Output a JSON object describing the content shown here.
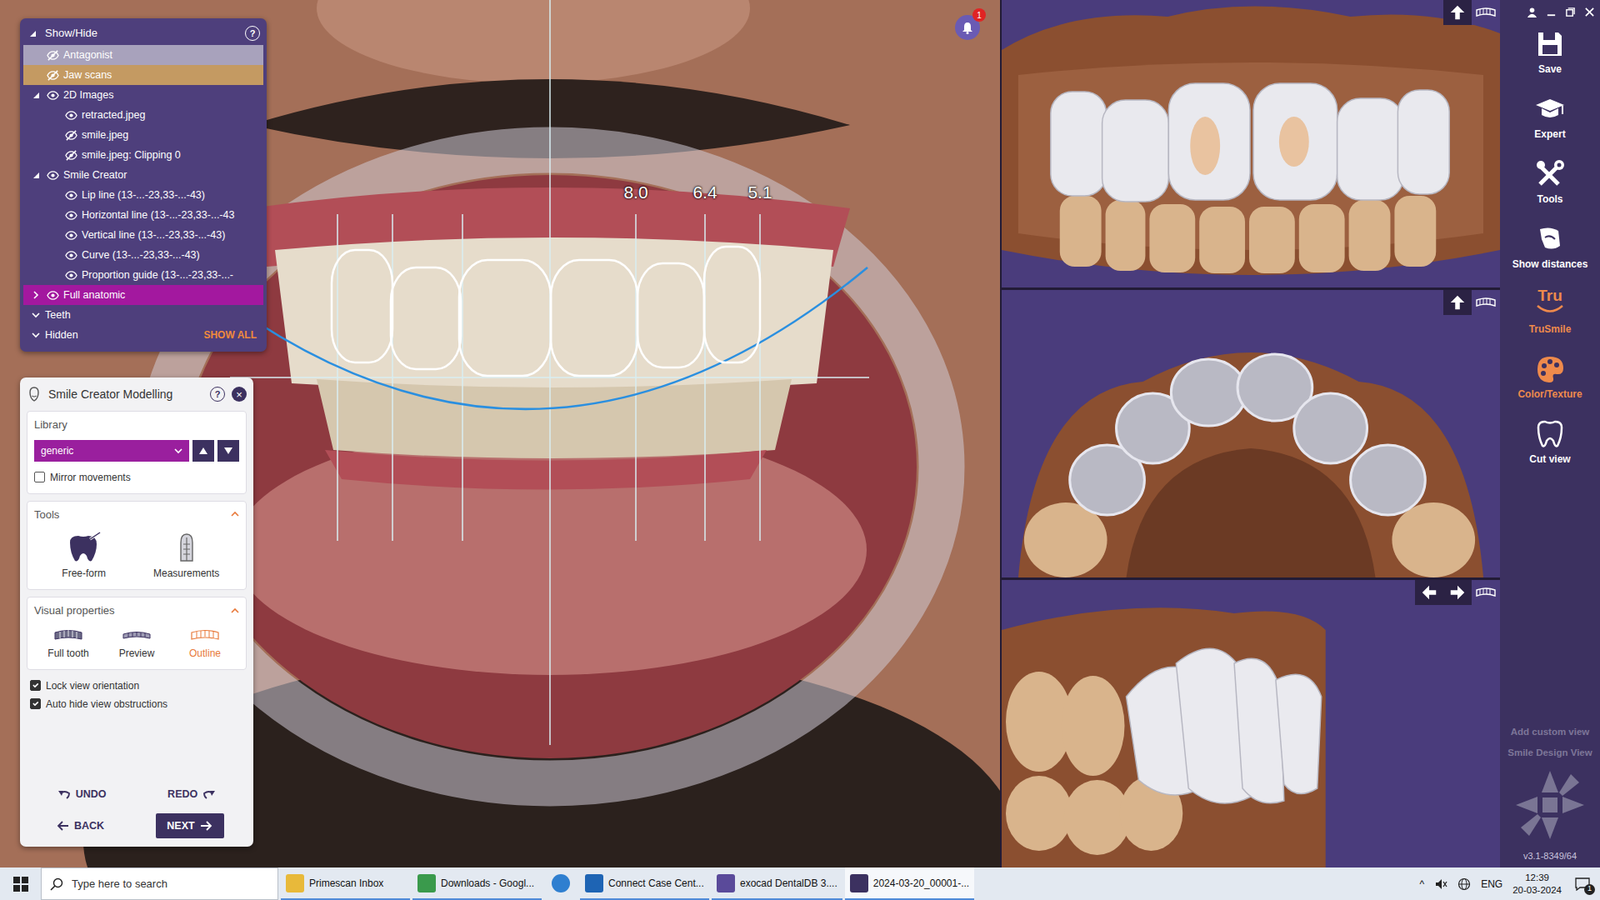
{
  "photo_view": {
    "measurements": [
      "8.0",
      "6.4",
      "5.1"
    ],
    "notifications": "1"
  },
  "show_hide": {
    "title": "Show/Hide",
    "expanded": true,
    "help": "?",
    "items": [
      {
        "label": "Antagonist",
        "kind": "item",
        "visible": false,
        "color": "#a8a2bc"
      },
      {
        "label": "Jaw scans",
        "kind": "item",
        "visible": false,
        "color": "#c49a62"
      },
      {
        "label": "2D Images",
        "kind": "group",
        "expanded": true,
        "visible": true,
        "color": "#4e3f7c"
      },
      {
        "label": "retracted.jpeg",
        "kind": "child",
        "visible": true,
        "color": "#4e3f7c"
      },
      {
        "label": "smile.jpeg",
        "kind": "child",
        "visible": false,
        "color": "#4e3f7c"
      },
      {
        "label": "smile.jpeg: Clipping 0",
        "kind": "child",
        "visible": false,
        "color": "#4e3f7c"
      },
      {
        "label": "Smile Creator",
        "kind": "group",
        "expanded": true,
        "visible": true,
        "color": "#4e3f7c"
      },
      {
        "label": "Lip line (13-...-23,33-...-43)",
        "kind": "child",
        "visible": true,
        "color": "#4e3f7c"
      },
      {
        "label": "Horizontal line (13-...-23,33-...-43",
        "kind": "child",
        "visible": true,
        "color": "#4e3f7c"
      },
      {
        "label": "Vertical line (13-...-23,33-...-43)",
        "kind": "child",
        "visible": true,
        "color": "#4e3f7c"
      },
      {
        "label": "Curve (13-...-23,33-...-43)",
        "kind": "child",
        "visible": true,
        "color": "#4e3f7c"
      },
      {
        "label": "Proportion guide (13-...-23,33-...-",
        "kind": "child",
        "visible": true,
        "color": "#4e3f7c"
      },
      {
        "label": "Full anatomic",
        "kind": "group",
        "expanded": false,
        "visible": true,
        "color": "#a3189f"
      },
      {
        "label": "Teeth",
        "kind": "section",
        "expanded": false,
        "color": "#4e3f7c"
      },
      {
        "label": "Hidden",
        "kind": "section",
        "expanded": false,
        "color": "#4e3f7c",
        "action": "SHOW ALL"
      }
    ]
  },
  "modelling": {
    "title": "Smile Creator Modelling",
    "help": "?",
    "close": "×",
    "library": {
      "label": "Library",
      "value": "generic"
    },
    "mirror": {
      "label": "Mirror movements",
      "checked": false
    },
    "tools": {
      "title": "Tools",
      "expanded": true,
      "items": [
        {
          "label": "Free-form"
        },
        {
          "label": "Measurements"
        }
      ]
    },
    "visual": {
      "title": "Visual properties",
      "expanded": true,
      "items": [
        {
          "label": "Full tooth",
          "selected": false
        },
        {
          "label": "Preview",
          "selected": false
        },
        {
          "label": "Outline",
          "selected": true
        }
      ]
    },
    "options": [
      {
        "label": "Lock view orientation",
        "checked": true
      },
      {
        "label": "Auto hide view obstructions",
        "checked": true
      }
    ],
    "undo": "UNDO",
    "redo": "REDO",
    "back": "BACK",
    "next": "NEXT"
  },
  "toolbar": {
    "items": [
      {
        "label": "Save",
        "highlighted": false
      },
      {
        "label": "Expert",
        "highlighted": false
      },
      {
        "label": "Tools",
        "highlighted": false
      },
      {
        "label": "Show distances",
        "highlighted": false
      },
      {
        "label": "TruSmile",
        "highlighted": true,
        "logo": "Tru"
      },
      {
        "label": "Color/Texture",
        "highlighted": true
      },
      {
        "label": "Cut view",
        "highlighted": false
      }
    ],
    "views": [
      {
        "label": "Add custom view",
        "disabled": true
      },
      {
        "label": "Smile Design View",
        "disabled": true
      }
    ],
    "version": "v3.1-8349/64"
  },
  "taskbar": {
    "search": {
      "placeholder": "Type here to search"
    },
    "apps": [
      {
        "kind": "labeled",
        "label": "Primescan Inbox",
        "selected": false
      },
      {
        "kind": "labeled",
        "label": "Downloads - Googl...",
        "selected": false
      },
      {
        "kind": "icon",
        "selected": false
      },
      {
        "kind": "labeled",
        "label": "Connect Case Cent...",
        "selected": false
      },
      {
        "kind": "labeled",
        "label": "exocad DentalDB 3....",
        "selected": false
      },
      {
        "kind": "labeled",
        "label": "2024-03-20_00001-...",
        "selected": true
      }
    ],
    "tray": {
      "chevron": "^",
      "language": "ENG",
      "time": "12:39",
      "date": "20-03-2024",
      "notifications": "1"
    }
  }
}
